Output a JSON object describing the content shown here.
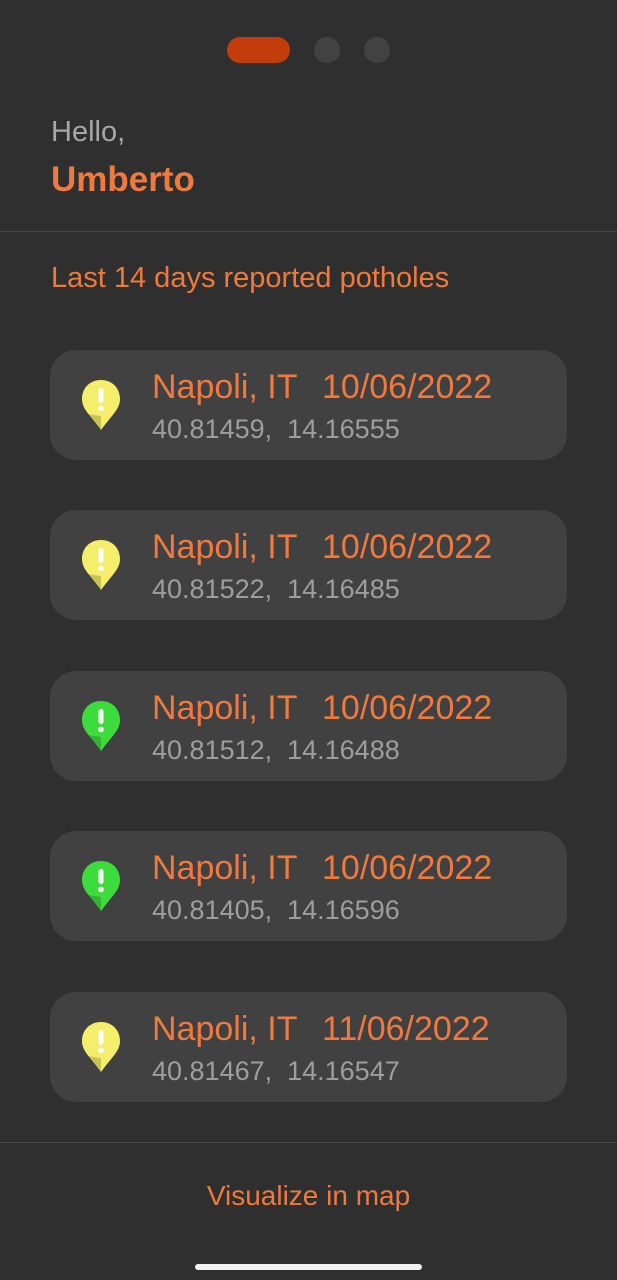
{
  "pager": {
    "count": 3,
    "active_index": 0,
    "active_color": "#c23d0a",
    "inactive_color": "#424242"
  },
  "header": {
    "greeting": "Hello,",
    "username": "Umberto"
  },
  "section": {
    "title": "Last 14 days reported potholes"
  },
  "reports": [
    {
      "place": "Napoli, IT",
      "date": "10/06/2022",
      "coords": "40.81459,  14.16555",
      "pin_icon": "yellow-warning-pin-icon",
      "pin_color": "#f5ee6a"
    },
    {
      "place": "Napoli, IT",
      "date": "10/06/2022",
      "coords": "40.81522,  14.16485",
      "pin_icon": "yellow-warning-pin-icon",
      "pin_color": "#f5ee6a"
    },
    {
      "place": "Napoli, IT",
      "date": "10/06/2022",
      "coords": "40.81512,  14.16488",
      "pin_icon": "green-warning-pin-icon",
      "pin_color": "#3ddc3d"
    },
    {
      "place": "Napoli, IT",
      "date": "10/06/2022",
      "coords": "40.81405,  14.16596",
      "pin_icon": "green-warning-pin-icon",
      "pin_color": "#3ddc3d"
    },
    {
      "place": "Napoli, IT",
      "date": "11/06/2022",
      "coords": "40.81467,  14.16547",
      "pin_icon": "yellow-warning-pin-icon",
      "pin_color": "#f5ee6a"
    }
  ],
  "footer": {
    "map_button_label": "Visualize in map"
  },
  "colors": {
    "accent": "#f07a3e",
    "background": "#2f2f2f",
    "card": "#414141"
  }
}
